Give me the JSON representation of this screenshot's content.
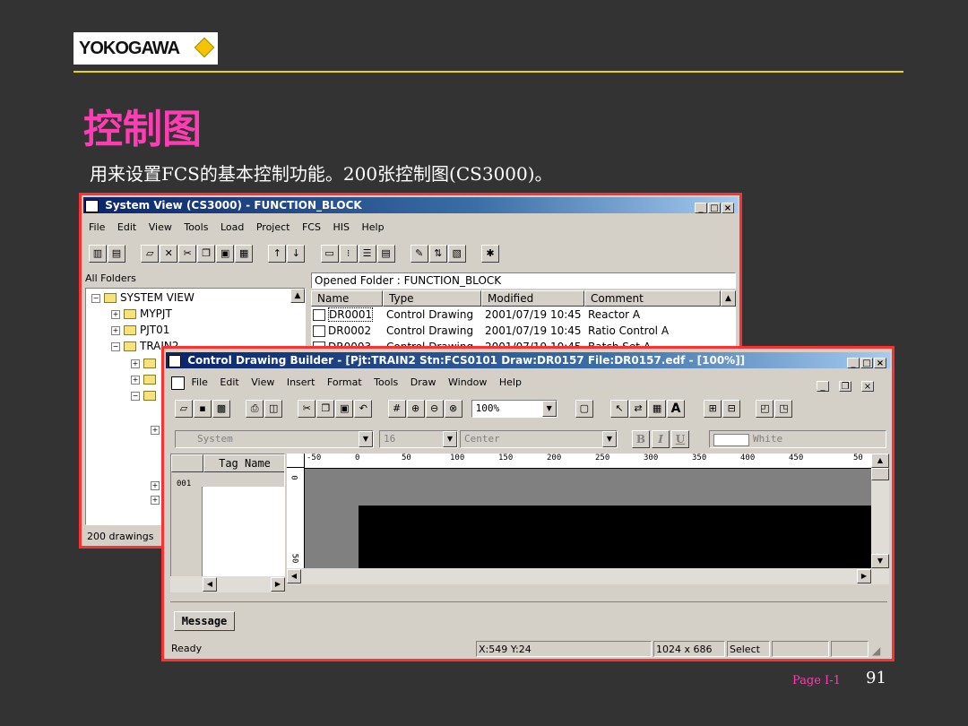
{
  "slide": {
    "logo_text": "YOKOGAWA",
    "title": "控制图",
    "subtitle": "用来设置FCS的基本控制功能。200张控制图(CS3000)。",
    "page_label": "Page I-1",
    "page_number": "91",
    "colors": {
      "background": "#333333",
      "title": "#ff3cb4",
      "rule": "#e8d800",
      "highlight_border": "#ff3030",
      "logo_diamond": "#f5c400"
    }
  },
  "system_view": {
    "title": "System View (CS3000) - FUNCTION_BLOCK",
    "menu": [
      "File",
      "Edit",
      "View",
      "Tools",
      "Load",
      "Project",
      "FCS",
      "HIS",
      "Help"
    ],
    "all_folders_label": "All Folders",
    "opened_folder_label": "Opened Folder : FUNCTION_BLOCK",
    "tree": [
      {
        "label": "SYSTEM VIEW",
        "toggle": "-"
      },
      {
        "label": "MYPJT",
        "toggle": "+"
      },
      {
        "label": "PJT01",
        "toggle": "+"
      },
      {
        "label": "TRAIN2",
        "toggle": "-"
      }
    ],
    "columns": [
      "Name",
      "Type",
      "Modified",
      "Comment"
    ],
    "rows": [
      {
        "name": "DR0001",
        "type": "Control Drawing",
        "modified": "2001/07/19 10:45",
        "comment": "Reactor A"
      },
      {
        "name": "DR0002",
        "type": "Control Drawing",
        "modified": "2001/07/19 10:45",
        "comment": "Ratio Control A"
      },
      {
        "name": "DR0003",
        "type": "Control Drawing",
        "modified": "2001/07/19 10:45",
        "comment": "Batch Set A"
      }
    ],
    "status": "200 drawings"
  },
  "builder": {
    "title": "Control Drawing Builder - [Pjt:TRAIN2 Stn:FCS0101 Draw:DR0157 File:DR0157.edf - [100%]]",
    "menu": [
      "File",
      "Edit",
      "View",
      "Insert",
      "Format",
      "Tools",
      "Draw",
      "Window",
      "Help"
    ],
    "zoom_value": "100%",
    "font_name": "System",
    "font_size": "16",
    "align": "Center",
    "color_name": "White",
    "bold_label": "B",
    "italic_label": "I",
    "underline_label": "U",
    "text_tool_label": "A",
    "tag_name_header": "Tag Name",
    "first_row": "001",
    "ruler_ticks": [
      "-50",
      "0",
      "50",
      "100",
      "150",
      "200",
      "250",
      "300",
      "350",
      "400",
      "450",
      "50"
    ],
    "vertical_ticks": [
      "0",
      "50"
    ],
    "message_tab": "Message",
    "status_ready": "Ready",
    "status_coords": "X:549 Y:24",
    "status_size": "1024 x 686",
    "status_mode": "Select",
    "canvas_color": "#808080",
    "block_color": "#000000"
  }
}
